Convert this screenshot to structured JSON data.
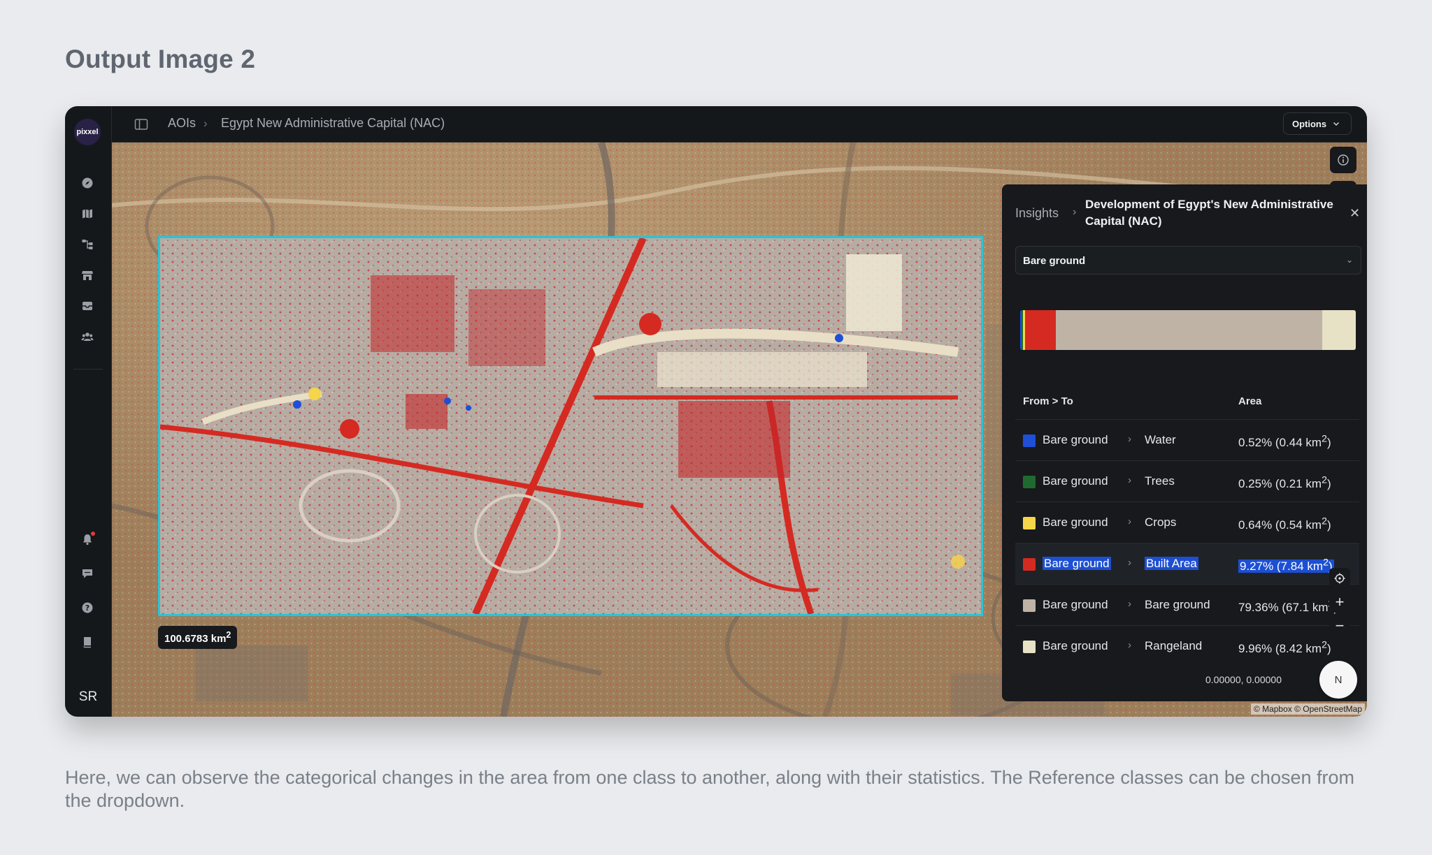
{
  "page_heading": "Output Image 2",
  "caption": "Here, we can observe the categorical changes in the area from one class to another, along with their statistics. The Reference classes can be chosen from the dropdown.",
  "app": {
    "logo_text": "pixxel",
    "breadcrumb": [
      "AOIs",
      "Egypt New Administrative Capital (NAC)"
    ],
    "options_label": "Options",
    "user_initials": "SR",
    "nav_icons": [
      "compass-icon",
      "map-icon",
      "workflow-icon",
      "store-icon",
      "archive-icon",
      "team-icon"
    ],
    "bottom_icons": [
      "bell-icon",
      "chat-icon",
      "help-icon",
      "book-icon"
    ],
    "right_tools": [
      "info-icon",
      "image-icon",
      "layers-icon",
      "split-view-icon",
      "chart-icon",
      "sparkle-icon",
      "map-icon",
      "layout-icon"
    ]
  },
  "map": {
    "area_label_value": "100.6783 km",
    "area_label_sup": "2",
    "coordinates": "0.00000, 0.00000",
    "attribution": "© Mapbox © OpenStreetMap",
    "compass_label": "N"
  },
  "panel": {
    "crumb": "Insights",
    "title": "Development of Egypt's New Administrative Capital (NAC)",
    "dropdown_value": "Bare ground",
    "header_from_to": "From > To",
    "header_area": "Area",
    "rows": [
      {
        "from": "Bare ground",
        "to": "Water",
        "area": "0.52% (0.44 km",
        "sup": "2",
        "close": ")",
        "color": "#1f4fd6",
        "pct": 0.52
      },
      {
        "from": "Bare ground",
        "to": "Trees",
        "area": "0.25% (0.21 km",
        "sup": "2",
        "close": ")",
        "color": "#1f6b2f",
        "pct": 0.25
      },
      {
        "from": "Bare ground",
        "to": "Crops",
        "area": "0.64% (0.54 km",
        "sup": "2",
        "close": ")",
        "color": "#f5d54a",
        "pct": 0.64
      },
      {
        "from": "Bare ground",
        "to": "Built Area",
        "area": "9.27% (7.84 km",
        "sup": "2",
        "close": ")",
        "color": "#d42a22",
        "pct": 9.27
      },
      {
        "from": "Bare ground",
        "to": "Bare ground",
        "area": "79.36% (67.1 km",
        "sup": "2",
        "close": ")",
        "color": "#bfb3a6",
        "pct": 79.36
      },
      {
        "from": "Bare ground",
        "to": "Rangeland",
        "area": "9.96% (8.42 km",
        "sup": "2",
        "close": ")",
        "color": "#e7e1c5",
        "pct": 9.96
      }
    ]
  }
}
